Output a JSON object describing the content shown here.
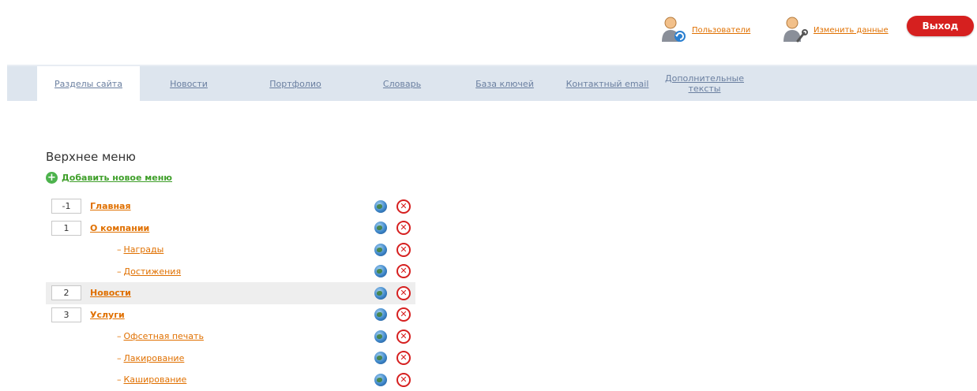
{
  "header": {
    "users_label": "Пользователи",
    "edit_label": "Изменить данные",
    "logout_label": "Выход"
  },
  "tabs": [
    {
      "label": "Разделы сайта",
      "active": true
    },
    {
      "label": "Новости"
    },
    {
      "label": "Портфолио"
    },
    {
      "label": "Словарь"
    },
    {
      "label": "База ключей"
    },
    {
      "label": "Контактный email"
    },
    {
      "label": "Дополнительные тексты"
    }
  ],
  "main": {
    "section_title": "Верхнее меню",
    "add_label": "Добавить новое меню",
    "items": [
      {
        "order": "-1",
        "label": "Главная",
        "level": 1
      },
      {
        "order": "1",
        "label": "О компании",
        "level": 1
      },
      {
        "label": "Награды",
        "level": 2
      },
      {
        "label": "Достижения",
        "level": 2
      },
      {
        "order": "2",
        "label": "Новости",
        "level": 1,
        "highlighted": true
      },
      {
        "order": "3",
        "label": "Услуги",
        "level": 1
      },
      {
        "label": "Офсетная печать",
        "level": 2
      },
      {
        "label": "Лакирование",
        "level": 2
      },
      {
        "label": "Каширование",
        "level": 2
      }
    ],
    "sub_prefix": "–"
  },
  "colors": {
    "accent_link": "#e07000",
    "logout_bg": "#d6201f",
    "tabbar_bg": "#dde5ee",
    "add_green": "#3f9f2a"
  },
  "icons": {
    "users": "users-refresh-icon",
    "edit": "user-wrench-icon",
    "add": "plus-circle-icon",
    "view": "globe-icon",
    "delete": "delete-x-icon"
  }
}
